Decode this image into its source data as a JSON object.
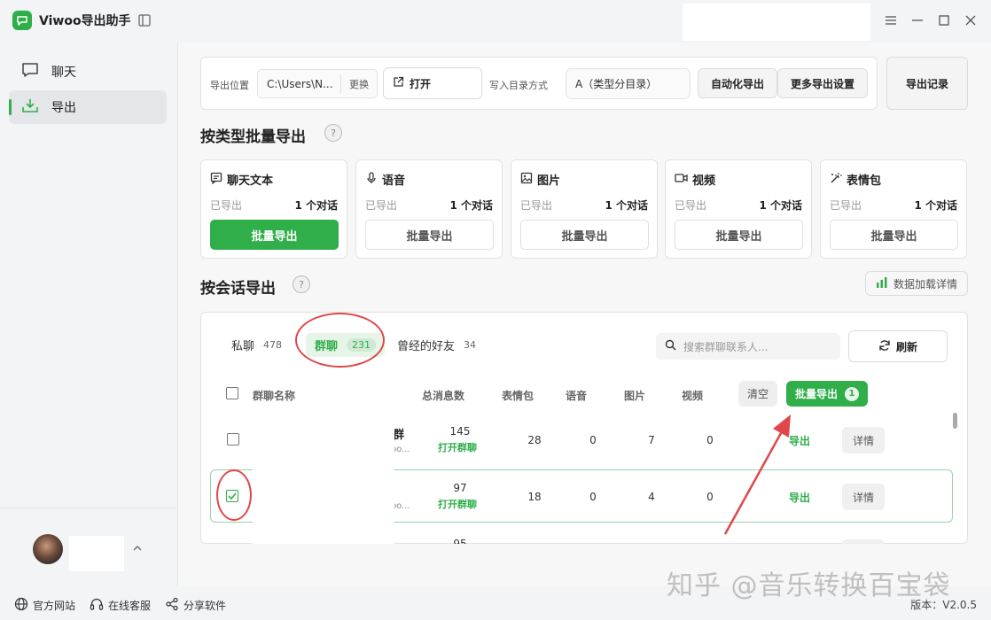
{
  "app": {
    "title": "Viwoo导出助手"
  },
  "sidebar": {
    "items": [
      {
        "label": "聊天",
        "icon": "chat-icon"
      },
      {
        "label": "导出",
        "icon": "download-icon"
      }
    ]
  },
  "footer": {
    "website": "官方网站",
    "support": "在线客服",
    "share": "分享软件",
    "version": "版本：V2.0.5"
  },
  "toolbar": {
    "export_location_label": "导出位置",
    "export_path": "C:\\Users\\N...",
    "change_label": "更换",
    "open_label": "打开",
    "dir_mode_label": "写入目录方式",
    "dir_mode_value": "A（类型分目录）",
    "auto_export": "自动化导出",
    "more_settings": "更多导出设置",
    "export_records": "导出记录"
  },
  "batch_by_type": {
    "title": "按类型批量导出",
    "help": "?",
    "cards": [
      {
        "title": "聊天文本",
        "exported_label": "已导出",
        "count": "1 个对话",
        "button": "批量导出",
        "primary": true
      },
      {
        "title": "语音",
        "exported_label": "已导出",
        "count": "1 个对话",
        "button": "批量导出",
        "primary": false
      },
      {
        "title": "图片",
        "exported_label": "已导出",
        "count": "1 个对话",
        "button": "批量导出",
        "primary": false
      },
      {
        "title": "视频",
        "exported_label": "已导出",
        "count": "1 个对话",
        "button": "批量导出",
        "primary": false
      },
      {
        "title": "表情包",
        "exported_label": "已导出",
        "count": "1 个对话",
        "button": "批量导出",
        "primary": false
      }
    ]
  },
  "by_session": {
    "title": "按会话导出",
    "help": "?",
    "load_details": "数据加载详情",
    "tabs": [
      {
        "label": "私聊",
        "count": "478"
      },
      {
        "label": "群聊",
        "count": "231"
      },
      {
        "label": "曾经的好友",
        "count": "34"
      }
    ],
    "search_placeholder": "搜索群聊联系人...",
    "refresh": "刷新",
    "columns": {
      "name": "群聊名称",
      "total": "总消息数",
      "sticker": "表情包",
      "voice": "语音",
      "image": "图片",
      "video": "视频"
    },
    "clear": "清空",
    "batch_export": "批量导出",
    "batch_count": "1",
    "rows": [
      {
        "name_fragment": "群",
        "sub_fragment": "oo...",
        "total": "145",
        "open": "打开群聊",
        "sticker": "28",
        "voice": "0",
        "image": "7",
        "video": "0",
        "export": "导出",
        "detail": "详情",
        "checked": false
      },
      {
        "name_fragment": "",
        "sub_fragment": "oo...",
        "total": "97",
        "open": "打开群聊",
        "sticker": "18",
        "voice": "0",
        "image": "4",
        "video": "0",
        "export": "导出",
        "detail": "详情",
        "checked": true
      },
      {
        "total": "95"
      }
    ]
  },
  "watermark": "知乎 @音乐转换百宝袋"
}
